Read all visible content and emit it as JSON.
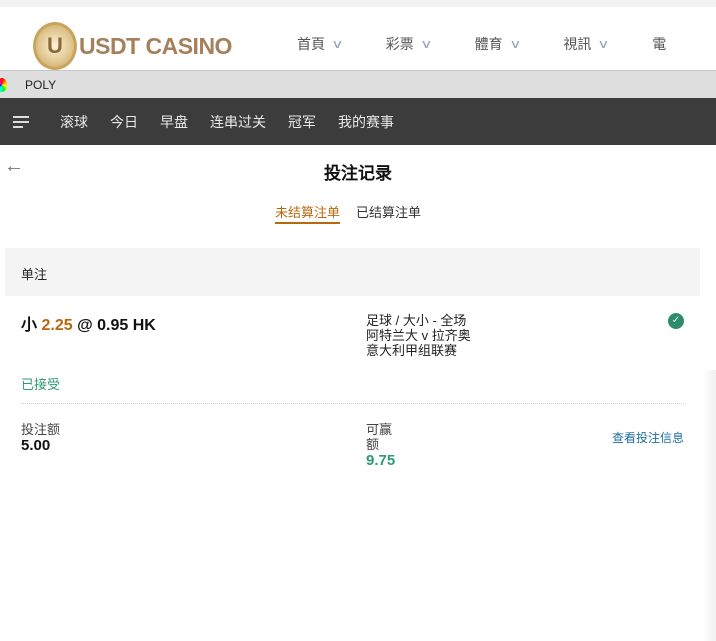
{
  "site": {
    "logo_text": "USDT CASINO",
    "logo_letter": "U",
    "nav": [
      {
        "label": "首頁"
      },
      {
        "label": "彩票"
      },
      {
        "label": "體育"
      },
      {
        "label": "視訊"
      },
      {
        "label": "電"
      }
    ]
  },
  "provider": {
    "label": "POLY"
  },
  "sports_nav": [
    "滚球",
    "今日",
    "早盘",
    "连串过关",
    "冠军",
    "我的赛事"
  ],
  "page": {
    "title": "投注记录",
    "tabs": [
      "未结算注单",
      "已结算注单"
    ],
    "active_tab": 0
  },
  "section": {
    "label": "单注"
  },
  "bet": {
    "pick": "小",
    "line": "2.25",
    "at": "@",
    "odds": "0.95 HK",
    "market": "足球 / 大小 - 全场",
    "match": "阿特兰大 v 拉齐奥",
    "league": "意大利甲组联赛",
    "status": "已接受",
    "stake_label": "投注额",
    "stake": "5.00",
    "win_label": "可赢额",
    "win": "9.75",
    "detail_link": "查看投注信息"
  },
  "colors": {
    "accent": "#b8680f",
    "success": "#2e9a7a",
    "link": "#1e6f9f"
  }
}
